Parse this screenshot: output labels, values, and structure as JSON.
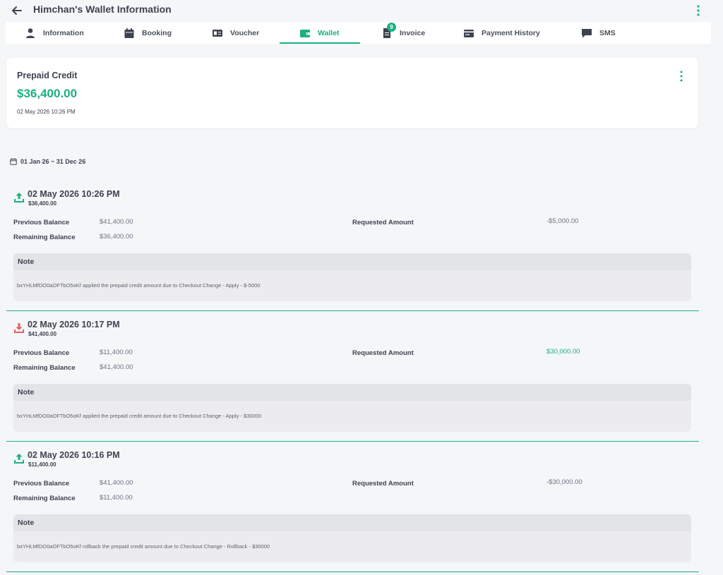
{
  "header": {
    "title": "Himchan's Wallet Information"
  },
  "tabs": [
    {
      "label": "Information",
      "icon": "person-icon"
    },
    {
      "label": "Booking",
      "icon": "calendar-icon"
    },
    {
      "label": "Voucher",
      "icon": "ticket-icon"
    },
    {
      "label": "Wallet",
      "icon": "wallet-icon",
      "active": true
    },
    {
      "label": "Invoice",
      "icon": "invoice-icon",
      "badge": "9"
    },
    {
      "label": "Payment History",
      "icon": "credit-card-icon"
    },
    {
      "label": "SMS",
      "icon": "chat-icon"
    }
  ],
  "credit": {
    "label": "Prepaid Credit",
    "amount": "$36,400.00",
    "date": "02 May 2026 10:26 PM"
  },
  "filter": {
    "date_range": "01 Jan 26 ~ 31 Dec 26"
  },
  "labels": {
    "previous_balance": "Previous Balance",
    "remaining_balance": "Remaining Balance",
    "requested_amount": "Requested Amount",
    "note": "Note"
  },
  "entries": [
    {
      "date": "02 May 2026 10:26 PM",
      "amount": "$36,400.00",
      "direction": "out",
      "previous_balance": "$41,400.00",
      "remaining_balance": "$36,400.00",
      "requested_amount": "-$5,000.00",
      "note": "bxYHLMfDO0aOFTbO5oKf applied the prepaid credit amount due to Checkout Change - Apply - $-5000"
    },
    {
      "date": "02 May 2026 10:17 PM",
      "amount": "$41,400.00",
      "direction": "in",
      "previous_balance": "$11,400.00",
      "remaining_balance": "$41,400.00",
      "requested_amount": "$30,000.00",
      "note": "bxYHLMfDO0aOFTbO5oKf applied the prepaid credit amount due to Checkout Change - Apply - $30000"
    },
    {
      "date": "02 May 2026 10:16 PM",
      "amount": "$11,400.00",
      "direction": "out",
      "previous_balance": "$41,400.00",
      "remaining_balance": "$11,400.00",
      "requested_amount": "-$30,000.00",
      "note": "bxYHLMfDO0aOFTbO5oKf rollback the prepaid credit amount due to Checkout Change - Rollback - $30000"
    }
  ],
  "colors": {
    "accent": "#1bb07f",
    "incoming": "#e2625b",
    "text": "#3d4350"
  }
}
